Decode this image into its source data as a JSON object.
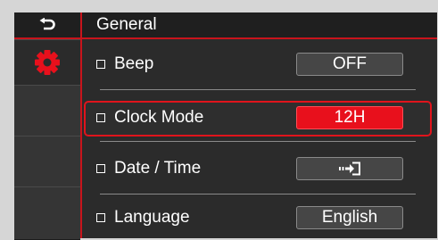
{
  "header": {
    "back_icon": "back-arrow-icon",
    "title": "General"
  },
  "sidebar": {
    "active_icon": "gear-icon",
    "accent_color": "#e8101c"
  },
  "settings": [
    {
      "label": "Beep",
      "value": "OFF",
      "selected": false
    },
    {
      "label": "Clock Mode",
      "value": "12H",
      "selected": true
    },
    {
      "label": "Date / Time",
      "value_icon": "enter-arrow-icon",
      "selected": false
    },
    {
      "label": "Language",
      "value": "English",
      "selected": false
    }
  ]
}
